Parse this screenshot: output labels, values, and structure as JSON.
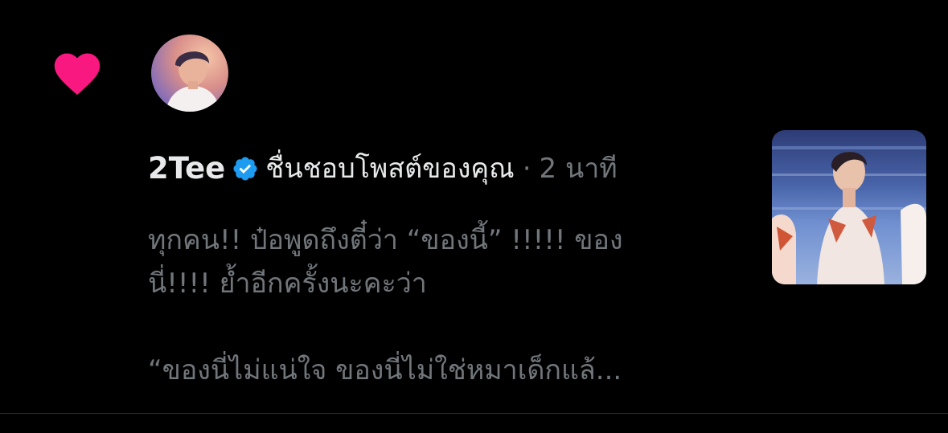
{
  "notification": {
    "type_icon": "heart-icon",
    "accent_color": "#f91880",
    "user": {
      "name": "2Tee",
      "verified": true,
      "verified_color": "#1d9bf0"
    },
    "action": "ชื่นชอบโพสต์ของคุณ",
    "separator": "·",
    "time": "2 นาที",
    "tweet_lines": [
      "ทุกคน!! ป๋อพูดถึงตี๋ว่า “ของนี้” !!!!! ของ",
      "นี่!!!! ย้ำอีกครั้งนะคะว่า",
      "",
      "“ของนี่ไม่แน่ใจ ของนี่ไม่ใช่หมาเด็กแล้..."
    ]
  }
}
